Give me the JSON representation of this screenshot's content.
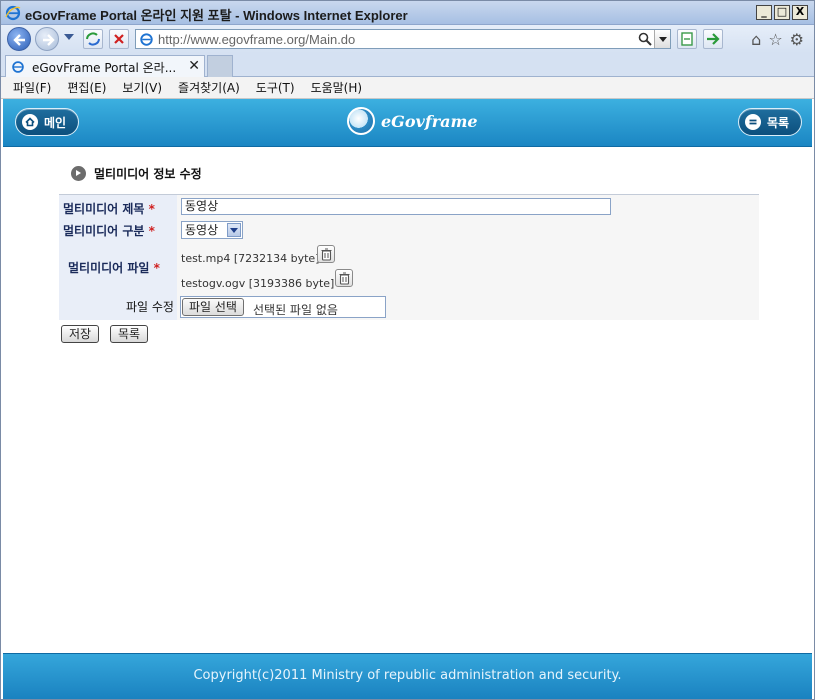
{
  "window": {
    "title": "eGovFrame Portal 온라인 지원 포탈 - Windows Internet Explorer",
    "controls": [
      "_",
      "□",
      "X"
    ]
  },
  "address_bar": {
    "url": "http://www.egovframe.org/Main.do"
  },
  "tabs": [
    {
      "label": "eGovFrame Portal 온라...",
      "close": "✕"
    }
  ],
  "menu": [
    "파일(F)",
    "편집(E)",
    "보기(V)",
    "즐겨찾기(A)",
    "도구(T)",
    "도움말(H)"
  ],
  "header": {
    "home_label": "메인",
    "logo_text": "eGovframe",
    "list_label": "목록"
  },
  "page": {
    "title": "멀티미디어 정보 수정"
  },
  "form": {
    "title_label": "멀티미디어 제목",
    "title_value": "동영상",
    "type_label": "멀티미디어 구분",
    "type_value": "동영상",
    "file_label": "멀티미디어 파일",
    "required_mark": "*",
    "files": [
      {
        "name": "test.mp4 [7232134 byte]"
      },
      {
        "name": "testogv.ogv [3193386 byte]"
      }
    ],
    "file_edit_label": "파일 수정",
    "file_button": "파일 선택",
    "file_status": "선택된 파일 없음"
  },
  "buttons": {
    "save": "저장",
    "list": "목록"
  },
  "footer": {
    "copyright": "Copyright(c)2011 Ministry of republic administration and security."
  },
  "colors": {
    "header_blue": "#1b86c3",
    "label_bg": "#e9eef8",
    "required_red": "#d02020"
  }
}
